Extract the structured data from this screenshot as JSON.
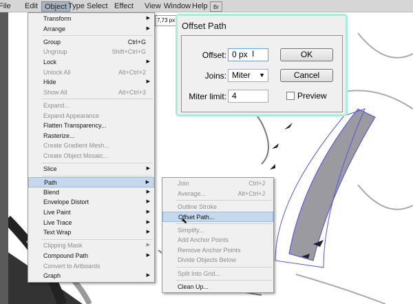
{
  "menubar": [
    "File",
    "Edit",
    "Object",
    "Type",
    "Select",
    "Effect",
    "View",
    "Window",
    "Help"
  ],
  "control": {
    "width_value": "7,73 px",
    "bridge_label": "Br"
  },
  "object_menu": [
    {
      "label": "Transform",
      "arrow": true
    },
    {
      "label": "Arrange",
      "arrow": true
    },
    {
      "sep": true
    },
    {
      "label": "Group",
      "shortcut": "Ctrl+G"
    },
    {
      "label": "Ungroup",
      "shortcut": "Shift+Ctrl+G",
      "disabled": true
    },
    {
      "label": "Lock",
      "arrow": true
    },
    {
      "label": "Unlock All",
      "shortcut": "Alt+Ctrl+2",
      "disabled": true
    },
    {
      "label": "Hide",
      "arrow": true
    },
    {
      "label": "Show All",
      "shortcut": "Alt+Ctrl+3",
      "disabled": true
    },
    {
      "sep": true
    },
    {
      "label": "Expand...",
      "disabled": true
    },
    {
      "label": "Expand Appearance",
      "disabled": true
    },
    {
      "label": "Flatten Transparency..."
    },
    {
      "label": "Rasterize..."
    },
    {
      "label": "Create Gradient Mesh...",
      "disabled": true
    },
    {
      "label": "Create Object Mosaic...",
      "disabled": true
    },
    {
      "sep": true
    },
    {
      "label": "Slice",
      "arrow": true
    },
    {
      "sep": true
    },
    {
      "label": "Path",
      "arrow": true,
      "highlight": true
    },
    {
      "label": "Blend",
      "arrow": true
    },
    {
      "label": "Envelope Distort",
      "arrow": true
    },
    {
      "label": "Live Paint",
      "arrow": true
    },
    {
      "label": "Live Trace",
      "arrow": true
    },
    {
      "label": "Text Wrap",
      "arrow": true
    },
    {
      "sep": true
    },
    {
      "label": "Clipping Mask",
      "arrow": true,
      "disabled": true
    },
    {
      "label": "Compound Path",
      "arrow": true
    },
    {
      "label": "Convert to Artboards",
      "disabled": true
    },
    {
      "label": "Graph",
      "arrow": true
    }
  ],
  "path_menu": [
    {
      "label": "Join",
      "shortcut": "Ctrl+J",
      "disabled": true
    },
    {
      "label": "Average...",
      "shortcut": "Alt+Ctrl+J",
      "disabled": true
    },
    {
      "sep": true
    },
    {
      "label": "Outline Stroke",
      "disabled": true
    },
    {
      "label": "Offset Path...",
      "highlight": true
    },
    {
      "sep": true
    },
    {
      "label": "Simplify...",
      "disabled": true
    },
    {
      "label": "Add Anchor Points",
      "disabled": true
    },
    {
      "label": "Remove Anchor Points",
      "disabled": true
    },
    {
      "label": "Divide Objects Below",
      "disabled": true
    },
    {
      "sep": true
    },
    {
      "label": "Split Into Grid...",
      "disabled": true
    },
    {
      "sep": true
    },
    {
      "label": "Clean Up..."
    }
  ],
  "dialog": {
    "title": "Offset Path",
    "offset_label": "Offset:",
    "offset_value": "0 px",
    "joins_label": "Joins:",
    "joins_value": "Miter",
    "miter_label": "Miter limit:",
    "miter_value": "4",
    "ok": "OK",
    "cancel": "Cancel",
    "preview": "Preview",
    "accent": "#a8ecd9"
  }
}
